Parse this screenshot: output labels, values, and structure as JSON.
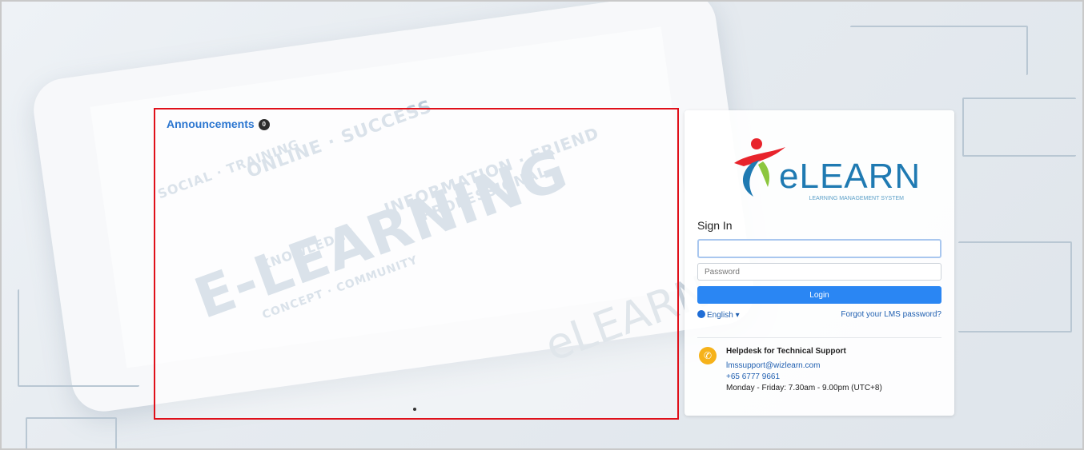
{
  "announcements": {
    "title": "Announcements",
    "count": "0"
  },
  "brand": {
    "name": "eLEARN",
    "tagline": "LEARNING MANAGEMENT SYSTEM"
  },
  "sign_in": {
    "title": "Sign In",
    "username_value": "",
    "password_placeholder": "Password",
    "login_label": "Login",
    "language": "English",
    "forgot_label": "Forgot your LMS password?"
  },
  "helpdesk": {
    "title": "Helpdesk for Technical Support",
    "email": "lmssupport@wizlearn.com",
    "phone": "+65 6777 9661",
    "hours": "Monday - Friday: 7.30am - 9.00pm (UTC+8)"
  },
  "colors": {
    "accent": "#2a86f3",
    "link": "#1f5fb0",
    "highlight_border": "#e0101a",
    "phone_badge": "#f6b21a"
  }
}
